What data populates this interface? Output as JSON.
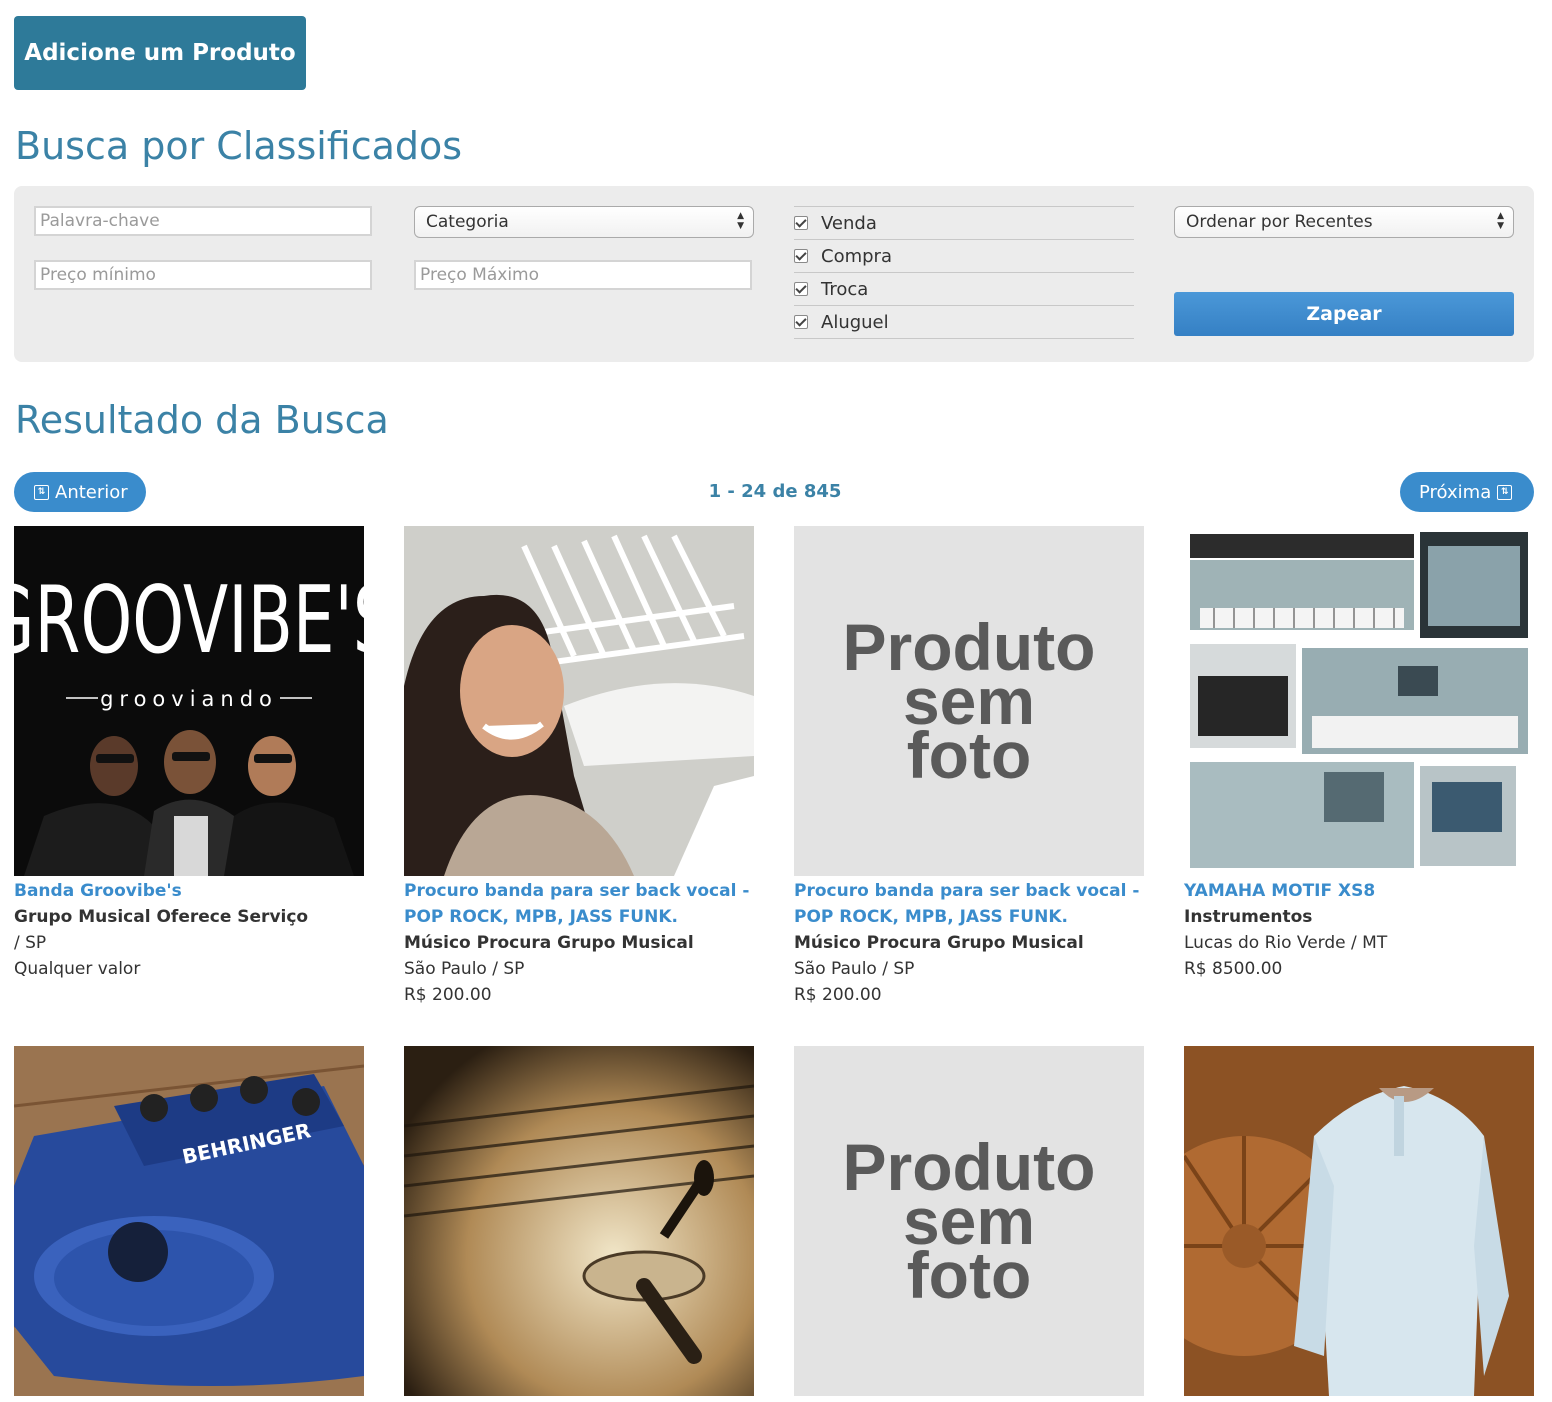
{
  "header": {
    "add_product_label": "Adicione um Produto"
  },
  "search": {
    "title": "Busca por Classificados",
    "keyword_placeholder": "Palavra-chave",
    "min_price_placeholder": "Preço mínimo",
    "max_price_placeholder": "Preço Máximo",
    "category_selected": "Categoria",
    "types": [
      "Venda",
      "Compra",
      "Troca",
      "Aluguel"
    ],
    "sort_selected": "Ordenar por Recentes",
    "submit_label": "Zapear"
  },
  "results": {
    "title": "Resultado da Busca",
    "prev_label": "Anterior",
    "next_label": "Próxima",
    "counter": "1 - 24 de 845",
    "no_photo_lines": [
      "Produto",
      "sem",
      "foto"
    ],
    "items": [
      {
        "title": "Banda Groovibe's",
        "category": "Grupo Musical Oferece Serviço",
        "location": "/ SP",
        "price": "Qualquer valor",
        "image": "groovibes-band-photo"
      },
      {
        "title": "Procuro banda para ser back vocal - POP ROCK, MPB, JASS FUNK.",
        "category": "Músico Procura Grupo Musical",
        "location": "São Paulo / SP",
        "price": "R$ 200.00",
        "image": "woman-selfie-photo"
      },
      {
        "title": "Procuro banda para ser back vocal - POP ROCK, MPB, JASS FUNK.",
        "category": "Músico Procura Grupo Musical",
        "location": "São Paulo / SP",
        "price": "R$ 200.00",
        "image": "no-photo"
      },
      {
        "title": "YAMAHA MOTIF XS8",
        "category": "Instrumentos",
        "location": "Lucas do Rio Verde / MT",
        "price": "R$ 8500.00",
        "image": "yamaha-keyboard-photo"
      },
      {
        "image": "guitar-pedal-photo"
      },
      {
        "image": "guitar-closeup-photo"
      },
      {
        "image": "no-photo"
      },
      {
        "image": "man-shirt-photo"
      }
    ]
  }
}
